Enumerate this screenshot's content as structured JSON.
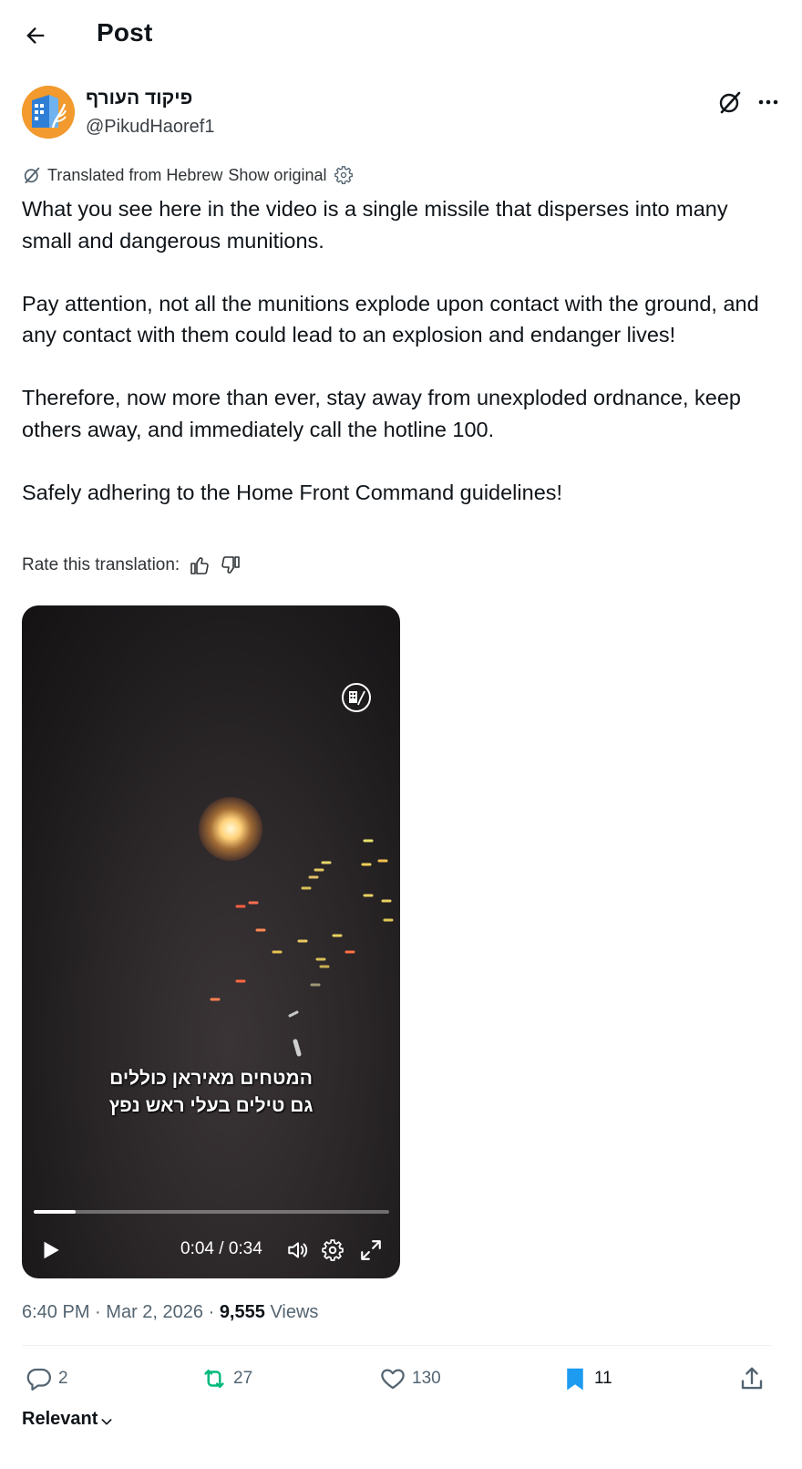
{
  "header": {
    "title": "Post"
  },
  "author": {
    "display_name": "פיקוד העורף",
    "handle": "@PikudHaoref1"
  },
  "translation": {
    "label": "Translated from Hebrew",
    "show_original": "Show original",
    "rate_label": "Rate this translation:"
  },
  "post": {
    "paragraphs": [
      "What you see here in the video is a single missile that disperses into many small and dangerous munitions.",
      "Pay attention, not all the munitions explode upon contact with the ground, and any contact with them could lead to an explosion and endanger lives!",
      "Therefore, now more than ever, stay away from unexploded ordnance, keep others away, and immediately call the hotline 100.",
      "Safely adhering to the Home Front Command guidelines!"
    ]
  },
  "video": {
    "subtitle_line1": "המטחים מאיראן כוללים",
    "subtitle_line2": "גם טילים בעלי ראש נפץ",
    "time_display": "0:04 / 0:34",
    "progress_fraction": 0.118
  },
  "meta": {
    "time": "6:40 PM",
    "separator": "·",
    "date": "Mar 2, 2026",
    "views_count": "9,555",
    "views_label": "Views"
  },
  "actions": {
    "replies": "2",
    "reposts": "27",
    "likes": "130",
    "bookmarks": "11"
  },
  "sort": {
    "label": "Relevant"
  },
  "colors": {
    "text_primary": "#0f1419",
    "text_secondary": "#536471",
    "repost_green": "#00ba7c",
    "bookmark_blue": "#1d9bf0",
    "avatar_orange": "#f29a2e"
  }
}
